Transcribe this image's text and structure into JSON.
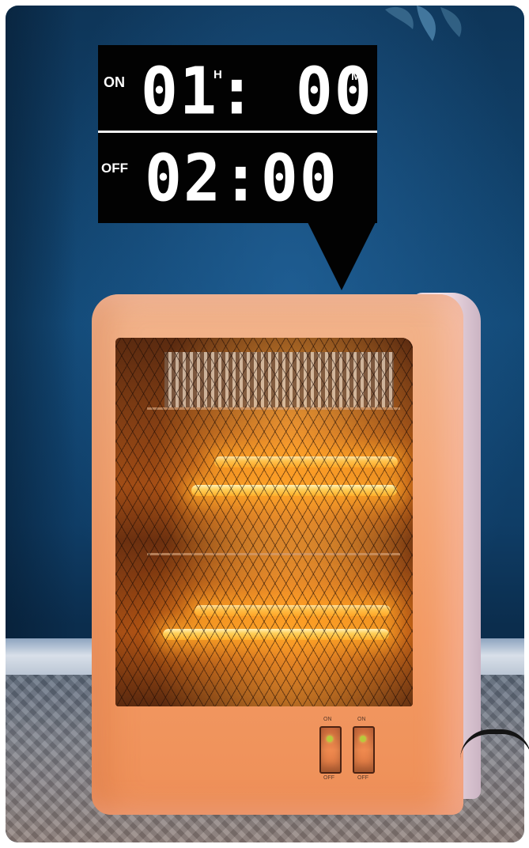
{
  "timer": {
    "on_label": "ON",
    "on_time": "01: 00",
    "hour_unit": "H",
    "minute_unit": "M",
    "off_label": "OFF",
    "off_time": "02:00"
  },
  "switches": {
    "left_on": "ON",
    "left_off": "OFF",
    "right_on": "ON",
    "right_off": "OFF"
  },
  "colors": {
    "wall": "#134a78",
    "heater_body": "#f4a776",
    "tube_glow": "#ffb02e",
    "timer_background": "#020202",
    "timer_text": "#ffffff"
  }
}
